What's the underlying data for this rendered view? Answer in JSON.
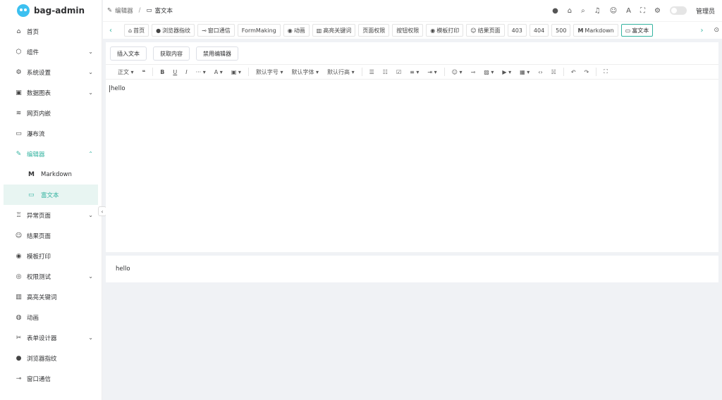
{
  "app": {
    "title": "bag-admin"
  },
  "sidebar": {
    "items": [
      {
        "label": "首页",
        "icon": "home-icon"
      },
      {
        "label": "组件",
        "icon": "cube-icon",
        "has_children": true
      },
      {
        "label": "系统设置",
        "icon": "gear-icon",
        "has_children": true
      },
      {
        "label": "数据图表",
        "icon": "chart-icon",
        "has_children": true
      },
      {
        "label": "网页内嵌",
        "icon": "layers-icon"
      },
      {
        "label": "瀑布流",
        "icon": "monitor-icon"
      },
      {
        "label": "编辑器",
        "icon": "edit-icon",
        "expanded": true
      },
      {
        "label": "异常页面",
        "icon": "bug-icon",
        "has_children": true
      },
      {
        "label": "结果页面",
        "icon": "smile-icon"
      },
      {
        "label": "模板打印",
        "icon": "record-icon"
      },
      {
        "label": "权限测试",
        "icon": "lock-icon",
        "has_children": true
      },
      {
        "label": "高亮关键词",
        "icon": "book-icon"
      },
      {
        "label": "动画",
        "icon": "animation-icon"
      },
      {
        "label": "表单设计器",
        "icon": "tools-icon",
        "has_children": true
      },
      {
        "label": "浏览器指纹",
        "icon": "fingerprint-icon"
      },
      {
        "label": "窗口通信",
        "icon": "link-icon"
      }
    ],
    "editor_children": [
      {
        "label": "Markdown",
        "icon": "M"
      },
      {
        "label": "富文本",
        "icon": "monitor-icon"
      }
    ]
  },
  "breadcrumb": {
    "parent": "编辑器",
    "current": "富文本"
  },
  "header": {
    "user": "管理员"
  },
  "tabs": [
    {
      "label": "首页",
      "icon": "⌂"
    },
    {
      "label": "浏览器指纹",
      "icon": "●"
    },
    {
      "label": "窗口通信",
      "icon": "⊸"
    },
    {
      "label": "FormMaking",
      "icon": ""
    },
    {
      "label": "动画",
      "icon": "◉"
    },
    {
      "label": "高亮关键词",
      "icon": "▥"
    },
    {
      "label": "页面权限",
      "icon": ""
    },
    {
      "label": "按钮权限",
      "icon": ""
    },
    {
      "label": "模板打印",
      "icon": "◉"
    },
    {
      "label": "结果页面",
      "icon": "☺"
    },
    {
      "label": "403",
      "icon": ""
    },
    {
      "label": "404",
      "icon": ""
    },
    {
      "label": "500",
      "icon": ""
    },
    {
      "label": "Markdown",
      "icon": "M"
    },
    {
      "label": "富文本",
      "icon": "▭"
    }
  ],
  "buttons": {
    "insert": "插入文本",
    "get": "获取内容",
    "disable": "禁用编辑器"
  },
  "toolbar": {
    "paragraph": "正文",
    "font_size": "默认字号",
    "font_family": "默认字体",
    "line_height": "默认行高"
  },
  "editor": {
    "content": "hello"
  },
  "preview": {
    "content": "hello"
  }
}
